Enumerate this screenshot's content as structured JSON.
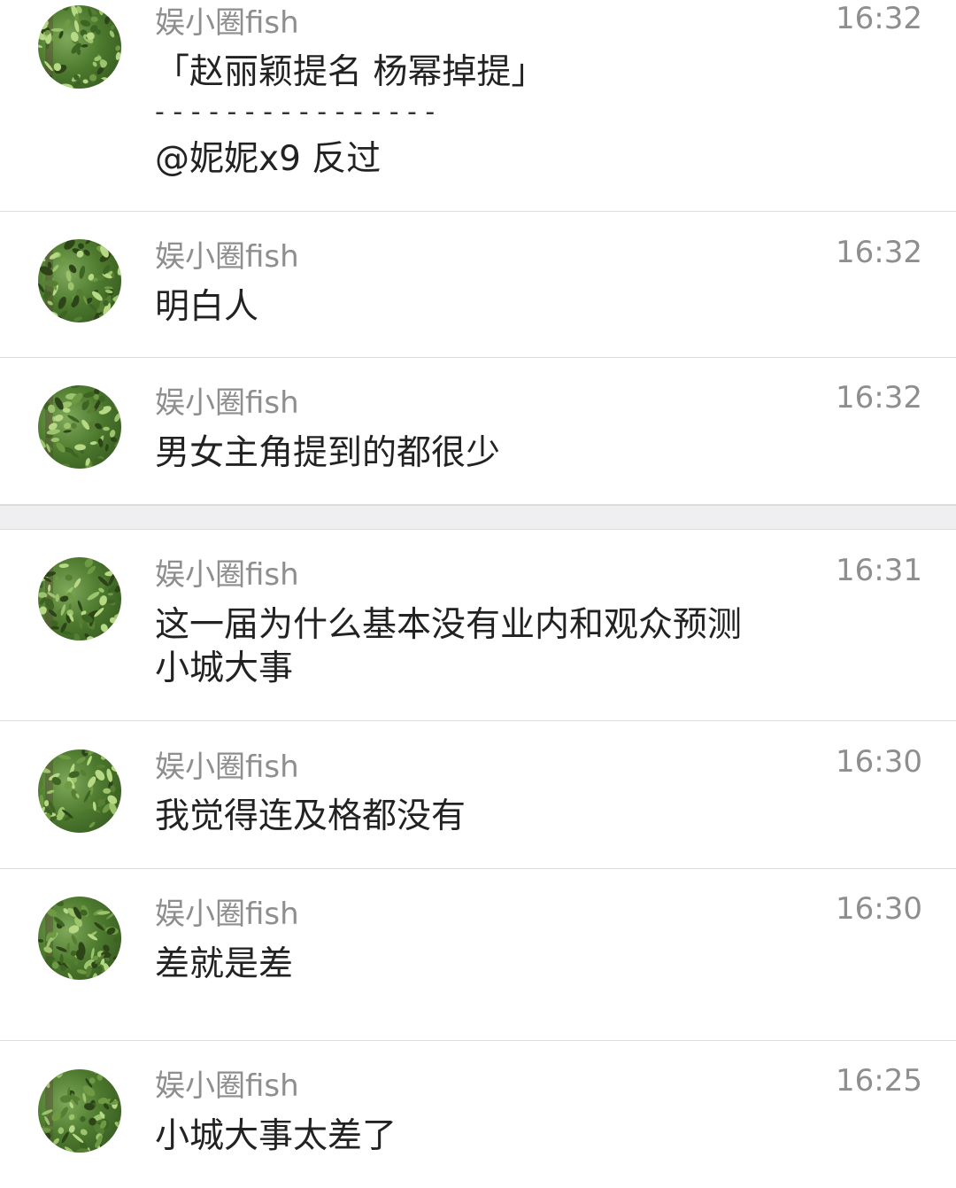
{
  "messages": [
    {
      "name": "娱小圈fish",
      "time": "16:32",
      "lines": [
        "「赵丽颖提名 杨幂掉提」",
        "- - - - - - - - - - - - - - - -",
        "@妮妮x9 反过"
      ]
    },
    {
      "name": "娱小圈fish",
      "time": "16:32",
      "lines": [
        "明白人"
      ]
    },
    {
      "name": "娱小圈fish",
      "time": "16:32",
      "lines": [
        "男女主角提到的都很少"
      ]
    },
    {
      "name": "娱小圈fish",
      "time": "16:31",
      "lines": [
        "这一届为什么基本没有业内和观众预测",
        "小城大事"
      ]
    },
    {
      "name": "娱小圈fish",
      "time": "16:30",
      "lines": [
        "我觉得连及格都没有"
      ]
    },
    {
      "name": "娱小圈fish",
      "time": "16:30",
      "lines": [
        "差就是差"
      ]
    },
    {
      "name": "娱小圈fish",
      "time": "16:25",
      "lines": [
        "小城大事太差了"
      ]
    }
  ],
  "icons": {
    "avatar": "leaf-avatar-icon"
  },
  "colors": {
    "name": "#8e8e8e",
    "text": "#222222",
    "divider": "#dcdcdc",
    "separator": "#efeff1"
  }
}
